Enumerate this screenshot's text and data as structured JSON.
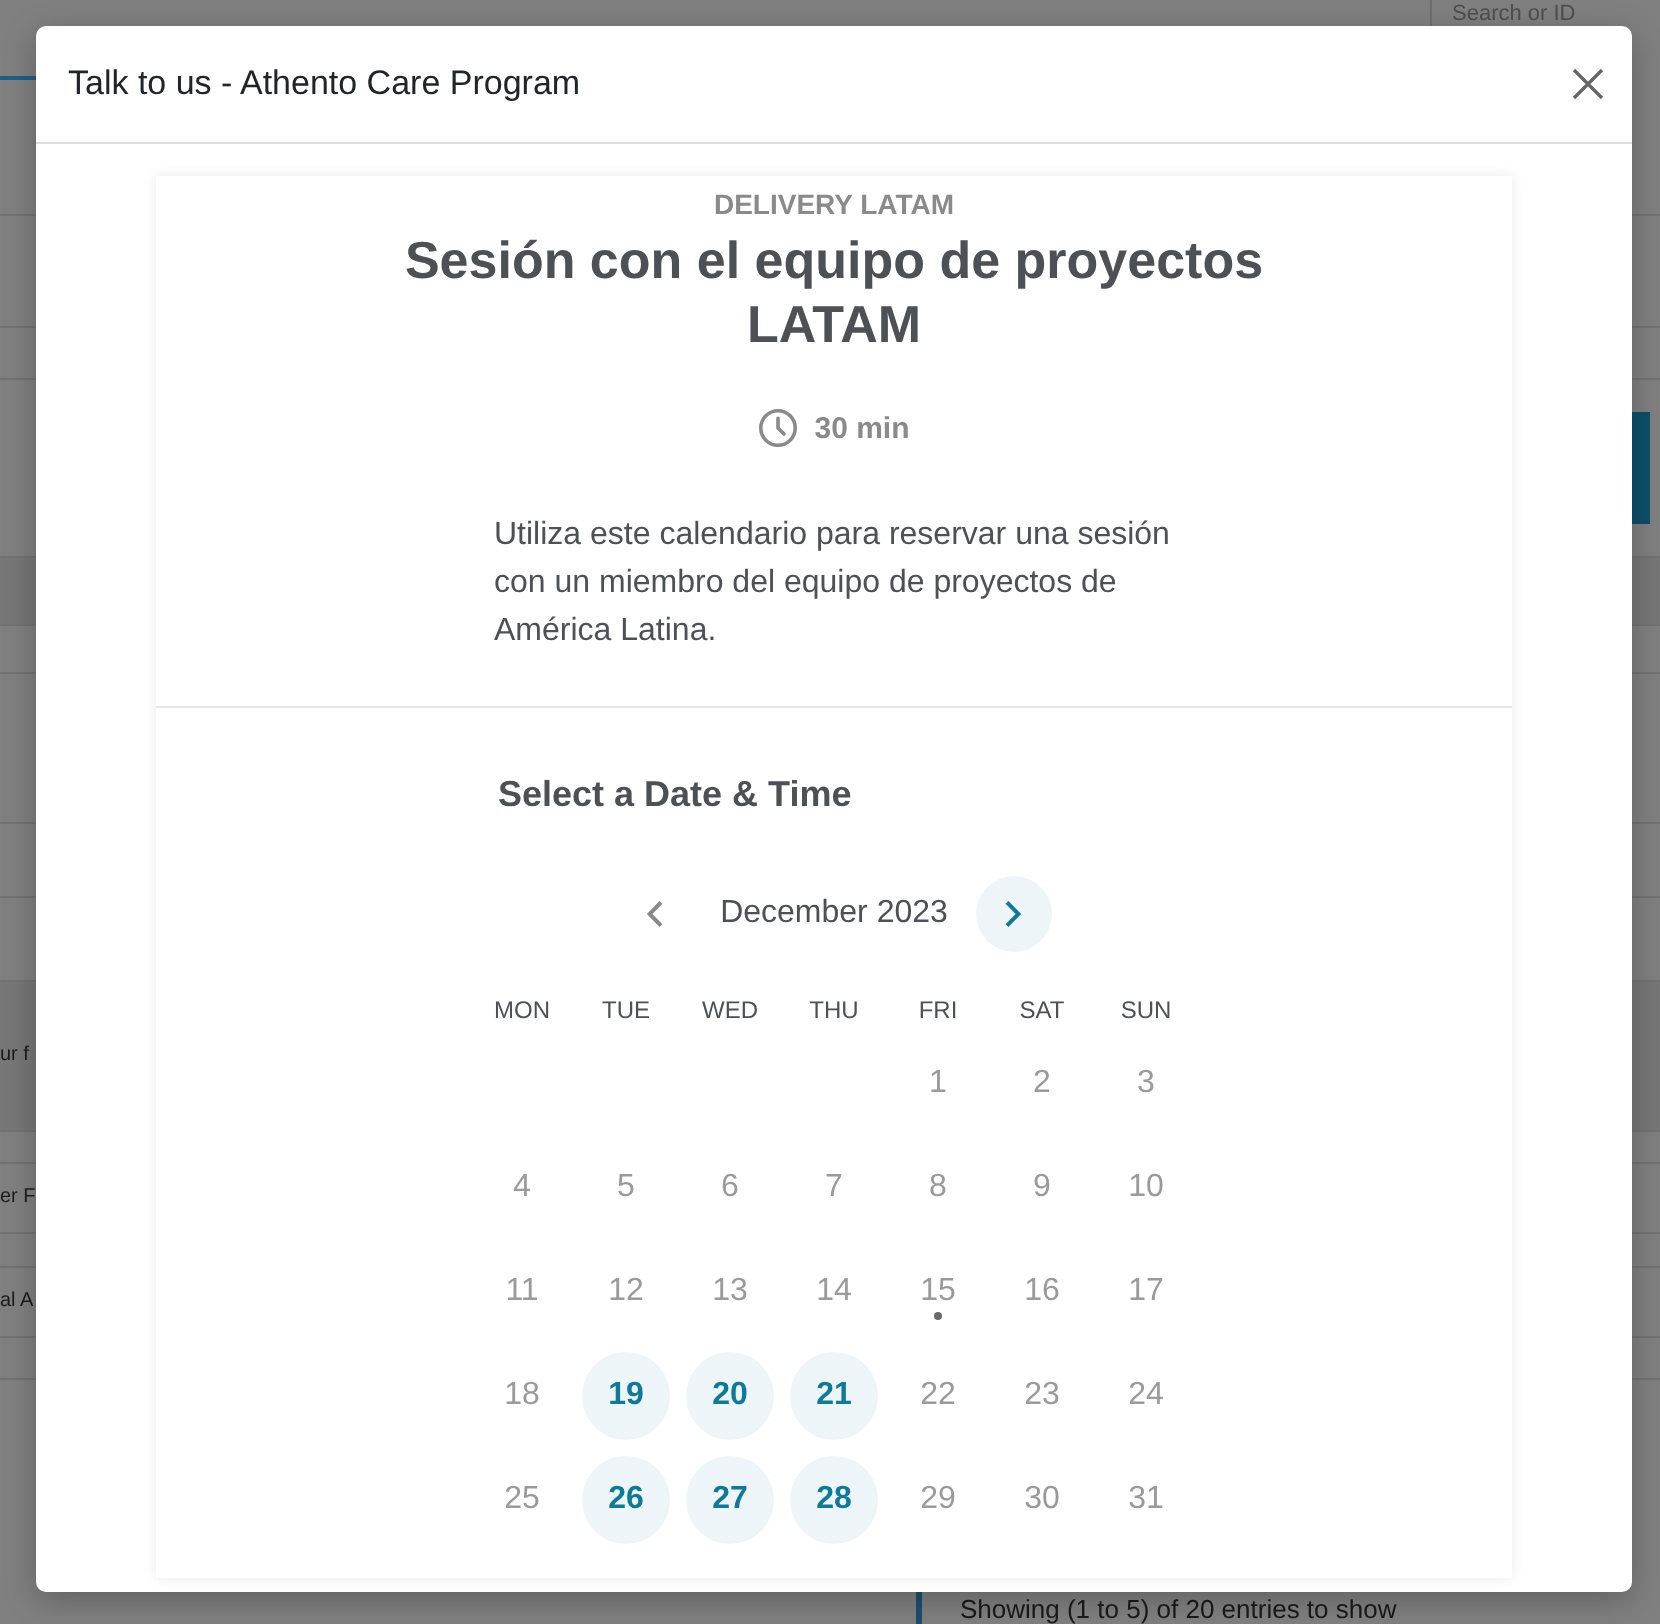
{
  "background_page": {
    "search_field": {
      "placeholder": "Search or ID"
    },
    "cut_texts": [
      "ur f",
      "er F",
      "al A"
    ],
    "footer_text": "Showing (1 to 5) of 20 entries to show"
  },
  "dialog": {
    "title": "Talk to us - Athento Care Program",
    "event": {
      "organizer": "DELIVERY LATAM",
      "title": "Sesión con el equipo de proyectos LATAM",
      "duration": "30 min",
      "description": "Utiliza este calendario para reservar una sesión con un miembro del equipo de proyectos de América Latina."
    },
    "scheduler": {
      "heading": "Select a Date & Time",
      "month": "December 2023",
      "prev_enabled": false,
      "next_enabled": true,
      "weekdays": [
        "MON",
        "TUE",
        "WED",
        "THU",
        "FRI",
        "SAT",
        "SUN"
      ],
      "weeks": [
        {
          "days": [
            {
              "label": "1",
              "available": false,
              "today": false
            },
            {
              "label": "2",
              "available": false,
              "today": false
            },
            {
              "label": "3",
              "available": false,
              "today": false
            }
          ]
        },
        {
          "days": [
            {
              "label": "4",
              "available": false,
              "today": false
            },
            {
              "label": "5",
              "available": false,
              "today": false
            },
            {
              "label": "6",
              "available": false,
              "today": false
            },
            {
              "label": "7",
              "available": false,
              "today": false
            },
            {
              "label": "8",
              "available": false,
              "today": false
            },
            {
              "label": "9",
              "available": false,
              "today": false
            },
            {
              "label": "10",
              "available": false,
              "today": false
            }
          ]
        },
        {
          "days": [
            {
              "label": "11",
              "available": false,
              "today": false
            },
            {
              "label": "12",
              "available": false,
              "today": false
            },
            {
              "label": "13",
              "available": false,
              "today": false
            },
            {
              "label": "14",
              "available": false,
              "today": false
            },
            {
              "label": "15",
              "available": false,
              "today": true
            },
            {
              "label": "16",
              "available": false,
              "today": false
            },
            {
              "label": "17",
              "available": false,
              "today": false
            }
          ]
        },
        {
          "days": [
            {
              "label": "18",
              "available": false,
              "today": false
            },
            {
              "label": "19",
              "available": true,
              "today": false
            },
            {
              "label": "20",
              "available": true,
              "today": false
            },
            {
              "label": "21",
              "available": true,
              "today": false
            },
            {
              "label": "22",
              "available": false,
              "today": false
            },
            {
              "label": "23",
              "available": false,
              "today": false
            },
            {
              "label": "24",
              "available": false,
              "today": false
            }
          ]
        },
        {
          "days": [
            {
              "label": "25",
              "available": false,
              "today": false
            },
            {
              "label": "26",
              "available": true,
              "today": false
            },
            {
              "label": "27",
              "available": true,
              "today": false
            },
            {
              "label": "28",
              "available": true,
              "today": false
            },
            {
              "label": "29",
              "available": false,
              "today": false
            },
            {
              "label": "30",
              "available": false,
              "today": false
            },
            {
              "label": "31",
              "available": false,
              "today": false
            }
          ]
        }
      ]
    }
  }
}
